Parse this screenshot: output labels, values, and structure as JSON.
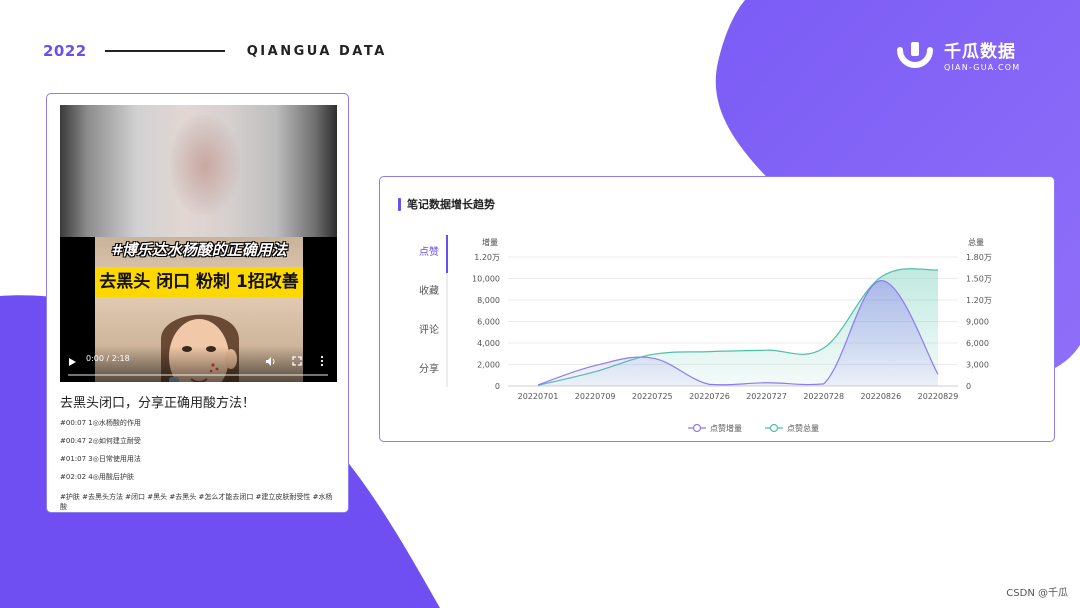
{
  "header": {
    "year": "2022",
    "brand": "QIANGUA DATA"
  },
  "logo": {
    "cn": "千瓜数据",
    "en": "QIAN-GUA.COM"
  },
  "video": {
    "thumb_hashtag": "#博乐达水杨酸的正确用法",
    "thumb_banner": "去黑头 闭口 粉刺 1招改善",
    "time": "0:00 / 2:18",
    "progress": 0
  },
  "note": {
    "title": "去黑头闭口，分享正确用酸方法！",
    "chapters": [
      "#00:07 1◎水杨酸的作用",
      "#00:47 2◎如何建立耐受",
      "#01:07 3◎日常使用用法",
      "#02:02 4◎用酸后护肤"
    ],
    "tags": "#护肤 #去黑头方法 #闭口 #黑头 #去黑头 #怎么才能去闭口 #建立皮肤耐受性 #水杨酸"
  },
  "chart_panel": {
    "heading": "笔记数据增长趋势",
    "tabs": [
      "点赞",
      "收藏",
      "评论",
      "分享"
    ],
    "active_tab": 0
  },
  "chart_data": {
    "type": "area",
    "categories": [
      "20220701",
      "20220709",
      "20220725",
      "20220726",
      "20220727",
      "20220728",
      "20220826",
      "20220829"
    ],
    "left_axis": {
      "label": "增量",
      "ylim": [
        0,
        12000
      ],
      "ticks": [
        "0",
        "2,000",
        "4,000",
        "6,000",
        "8,000",
        "10,000",
        "1.20万"
      ]
    },
    "right_axis": {
      "label": "总量",
      "ylim": [
        0,
        18000
      ],
      "ticks": [
        "0",
        "3,000",
        "6,000",
        "9,000",
        "1.20万",
        "1.50万",
        "1.80万"
      ]
    },
    "series": [
      {
        "name": "点赞增量",
        "axis": "left",
        "color": "#8b7cf0",
        "values": [
          100,
          1900,
          2600,
          150,
          300,
          200,
          9800,
          1100
        ]
      },
      {
        "name": "点赞总量",
        "axis": "right",
        "color": "#4ec1a8",
        "values": [
          100,
          2000,
          4400,
          4800,
          5000,
          5300,
          15200,
          16200
        ]
      }
    ],
    "grid": true,
    "legend": "bottom"
  }
}
